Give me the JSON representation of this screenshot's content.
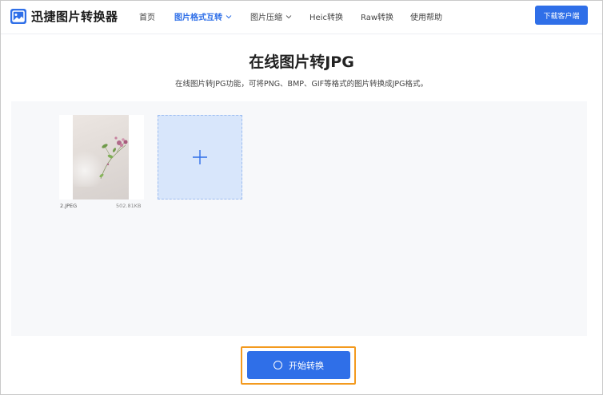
{
  "app": {
    "name": "迅捷图片转换器"
  },
  "nav": {
    "items": [
      {
        "label": "首页"
      },
      {
        "label": "图片格式互转"
      },
      {
        "label": "图片压缩"
      },
      {
        "label": "Heic转换"
      },
      {
        "label": "Raw转换"
      },
      {
        "label": "使用帮助"
      }
    ],
    "active_index": 1
  },
  "header": {
    "download_label": "下载客户端"
  },
  "main": {
    "title": "在线图片转JPG",
    "subtitle": "在线图片转JPG功能，可将PNG、BMP、GIF等格式的图片转换成JPG格式。"
  },
  "files": [
    {
      "name": "2.JPEG",
      "size": "502.81KB"
    }
  ],
  "actions": {
    "start_label": "开始转换"
  },
  "colors": {
    "accent": "#2f6fe8",
    "highlight_outline": "#f39a1f",
    "upload_bg": "#f7f8fa",
    "add_tile_bg": "#d8e6fb"
  },
  "icons": {
    "logo": "image-landscape-icon",
    "dropdown": "chevron-down-icon",
    "add": "plus-icon",
    "spinner": "ring-icon"
  }
}
